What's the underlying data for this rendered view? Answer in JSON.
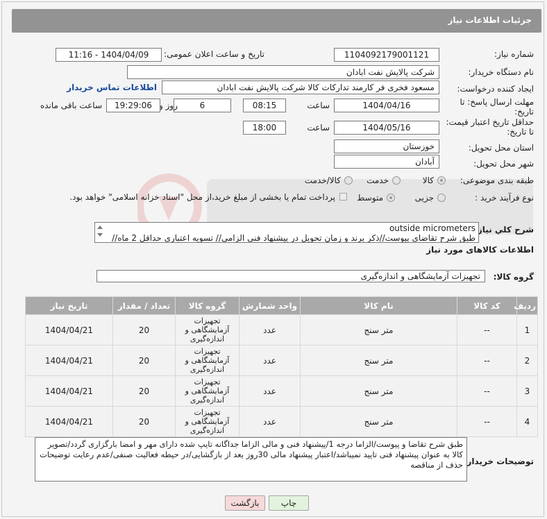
{
  "header": {
    "title": "جزئیات اطلاعات نیاز"
  },
  "fields": {
    "need_number_label": "شماره نیاز:",
    "need_number": "1104092179001121",
    "announce_label": "تاریخ و ساعت اعلان عمومی:",
    "announce_value": "1404/04/09 - 11:16",
    "buyer_org_label": "نام دستگاه خریدار:",
    "buyer_org": "شرکت پالایش نفت ابادان",
    "creator_label": "ایجاد کننده درخواست:",
    "creator": "مسعود فخری فر کارمند تدارکات کالا شرکت پالایش نفت ابادان",
    "contact_link": "اطلاعات تماس خریدار",
    "reply_deadline_label": "مهلت ارسال پاسخ: تا تاریخ:",
    "reply_date": "1404/04/16",
    "time_label": "ساعت",
    "reply_time": "08:15",
    "days": "6",
    "days_label": "روز و",
    "remaining_time": "19:29:06",
    "remaining_label": "ساعت باقی مانده",
    "price_deadline_label": "حداقل تاریخ اعتبار قیمت: تا تاریخ:",
    "price_date": "1404/05/16",
    "price_time": "18:00",
    "province_label": "استان محل تحویل:",
    "province": "خوزستان",
    "city_label": "شهر محل تحویل:",
    "city": "آبادان",
    "category_label": "طبقه بندی موضوعی:",
    "category_options": [
      "کالا",
      "خدمت",
      "کالا/خدمت"
    ],
    "process_label": "نوع فرآیند خرید :",
    "process_options": [
      "جزیی",
      "متوسط"
    ],
    "payment_note": "پرداخت تمام یا بخشی از مبلغ خرید،از محل \"اسناد خزانه اسلامی\" خواهد بود."
  },
  "description": {
    "label": "شرح کلي نياز:",
    "line1": "outside micrometers",
    "line2": "طبق شرح تقاضای پیوست//ذکر برند و زمان تحویل در پیشنهاد فنی الزامی// تسویه اعتباری حداقل 2 ماه//"
  },
  "goods_section": {
    "title": "اطلاعات کالاهای مورد نیاز",
    "group_label": "گروه کالا:",
    "group_value": "تجهیزات آزمایشگاهی و اندازه‌گیری"
  },
  "table": {
    "headers": [
      "ردیف",
      "کد کالا",
      "نام کالا",
      "واحد شمارش",
      "گروه کالا",
      "تعداد / مقدار",
      "تاریخ نیاز"
    ],
    "rows": [
      [
        "1",
        "--",
        "متر سنج",
        "عدد",
        "تجهیزات آزمایشگاهی و اندازه‌گیری",
        "20",
        "1404/04/21"
      ],
      [
        "2",
        "--",
        "متر سنج",
        "عدد",
        "تجهیزات آزمایشگاهی و اندازه‌گیری",
        "20",
        "1404/04/21"
      ],
      [
        "3",
        "--",
        "متر سنج",
        "عدد",
        "تجهیزات آزمایشگاهی و اندازه‌گیری",
        "20",
        "1404/04/21"
      ],
      [
        "4",
        "--",
        "متر سنج",
        "عدد",
        "تجهیزات آزمایشگاهی و اندازه‌گیری",
        "20",
        "1404/04/21"
      ]
    ]
  },
  "buyer_notes": {
    "label": "توضیحات خریدار:",
    "text": "طبق شرح تقاضا و پیوست/الزاما درجه 1/پیشنهاد فنی و مالی الزاما جداگانه تایپ شده دارای مهر و امضا بارگزاری گردد/تصویر کالا به عنوان پیشنهاد فنی تایید نمیباشد/اعتبار پیشنهاد مالی 30روز بعد از بازگشایی/در حیطه فعالیت صنفی/عدم رعایت توضیحات حذف از مناقصه"
  },
  "buttons": {
    "print": "چاپ",
    "back": "بازگشت"
  },
  "colors": {
    "header_bg": "#939393",
    "table_header_bg": "#a9a9a9",
    "link": "#1a4b9c",
    "back_btn": "#f7d9d9",
    "print_btn": "#e2f3dd"
  }
}
